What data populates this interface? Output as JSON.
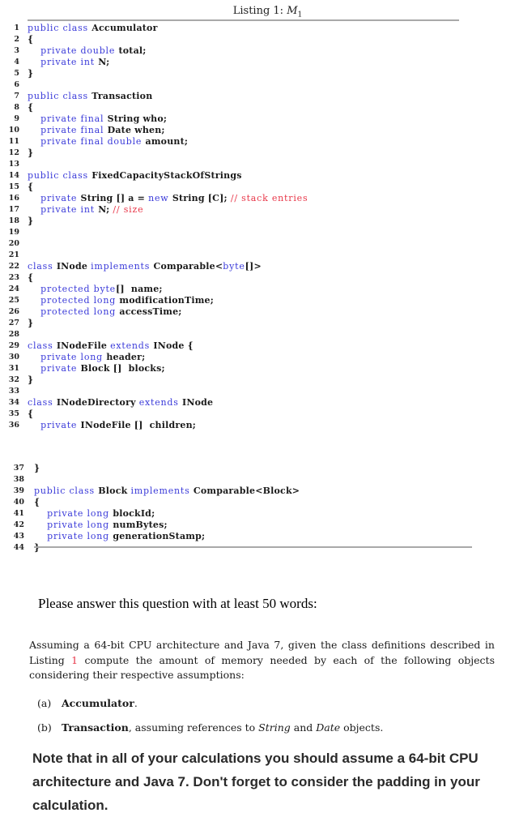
{
  "listing": {
    "caption_prefix": "Listing 1: ",
    "caption_math": "M",
    "caption_sub": "1"
  },
  "code_part_a": [
    {
      "n": "1",
      "tokens": [
        [
          "kw",
          "public class "
        ],
        [
          "tx",
          "Accumulator"
        ]
      ]
    },
    {
      "n": "2",
      "tokens": [
        [
          "tx",
          "{"
        ]
      ]
    },
    {
      "n": "3",
      "tokens": [
        [
          "tx",
          "    "
        ],
        [
          "kw",
          "private double "
        ],
        [
          "tx",
          "total;"
        ]
      ]
    },
    {
      "n": "4",
      "tokens": [
        [
          "tx",
          "    "
        ],
        [
          "kw",
          "private int "
        ],
        [
          "tx",
          "N;"
        ]
      ]
    },
    {
      "n": "5",
      "tokens": [
        [
          "tx",
          "}"
        ]
      ]
    },
    {
      "n": "6",
      "tokens": []
    },
    {
      "n": "7",
      "tokens": [
        [
          "kw",
          "public class "
        ],
        [
          "tx",
          "Transaction"
        ]
      ]
    },
    {
      "n": "8",
      "tokens": [
        [
          "tx",
          "{"
        ]
      ]
    },
    {
      "n": "9",
      "tokens": [
        [
          "tx",
          "    "
        ],
        [
          "kw",
          "private final "
        ],
        [
          "tx",
          "String who;"
        ]
      ]
    },
    {
      "n": "10",
      "tokens": [
        [
          "tx",
          "    "
        ],
        [
          "kw",
          "private final "
        ],
        [
          "tx",
          "Date when;"
        ]
      ]
    },
    {
      "n": "11",
      "tokens": [
        [
          "tx",
          "    "
        ],
        [
          "kw",
          "private final double "
        ],
        [
          "tx",
          "amount;"
        ]
      ]
    },
    {
      "n": "12",
      "tokens": [
        [
          "tx",
          "}"
        ]
      ]
    },
    {
      "n": "13",
      "tokens": []
    },
    {
      "n": "14",
      "tokens": [
        [
          "kw",
          "public class "
        ],
        [
          "tx",
          "FixedCapacityStackOfStrings"
        ]
      ]
    },
    {
      "n": "15",
      "tokens": [
        [
          "tx",
          "{"
        ]
      ]
    },
    {
      "n": "16",
      "tokens": [
        [
          "tx",
          "    "
        ],
        [
          "kw",
          "private "
        ],
        [
          "tx",
          "String [] a = "
        ],
        [
          "kw",
          "new "
        ],
        [
          "tx",
          "String [C]; "
        ],
        [
          "cm",
          "// stack entries"
        ]
      ]
    },
    {
      "n": "17",
      "tokens": [
        [
          "tx",
          "    "
        ],
        [
          "kw",
          "private int "
        ],
        [
          "tx",
          "N; "
        ],
        [
          "cm",
          "// size"
        ]
      ]
    },
    {
      "n": "18",
      "tokens": [
        [
          "tx",
          "}"
        ]
      ]
    },
    {
      "n": "19",
      "tokens": []
    },
    {
      "n": "20",
      "tokens": []
    },
    {
      "n": "21",
      "tokens": []
    },
    {
      "n": "22",
      "tokens": [
        [
          "kw",
          "class "
        ],
        [
          "tx",
          "INode "
        ],
        [
          "kw",
          "implements "
        ],
        [
          "tx",
          "Comparable<"
        ],
        [
          "kw",
          "byte"
        ],
        [
          "tx",
          "[]>"
        ]
      ]
    },
    {
      "n": "23",
      "tokens": [
        [
          "tx",
          "{"
        ]
      ]
    },
    {
      "n": "24",
      "tokens": [
        [
          "tx",
          "    "
        ],
        [
          "kw",
          "protected byte"
        ],
        [
          "tx",
          "[]  name;"
        ]
      ]
    },
    {
      "n": "25",
      "tokens": [
        [
          "tx",
          "    "
        ],
        [
          "kw",
          "protected long "
        ],
        [
          "tx",
          "modificationTime;"
        ]
      ]
    },
    {
      "n": "26",
      "tokens": [
        [
          "tx",
          "    "
        ],
        [
          "kw",
          "protected long "
        ],
        [
          "tx",
          "accessTime;"
        ]
      ]
    },
    {
      "n": "27",
      "tokens": [
        [
          "tx",
          "}"
        ]
      ]
    },
    {
      "n": "28",
      "tokens": []
    },
    {
      "n": "29",
      "tokens": [
        [
          "kw",
          "class "
        ],
        [
          "tx",
          "INodeFile "
        ],
        [
          "kw",
          "extends "
        ],
        [
          "tx",
          "INode {"
        ]
      ]
    },
    {
      "n": "30",
      "tokens": [
        [
          "tx",
          "    "
        ],
        [
          "kw",
          "private long "
        ],
        [
          "tx",
          "header;"
        ]
      ]
    },
    {
      "n": "31",
      "tokens": [
        [
          "tx",
          "    "
        ],
        [
          "kw",
          "private "
        ],
        [
          "tx",
          "Block []  blocks;"
        ]
      ]
    },
    {
      "n": "32",
      "tokens": [
        [
          "tx",
          "}"
        ]
      ]
    },
    {
      "n": "33",
      "tokens": []
    },
    {
      "n": "34",
      "tokens": [
        [
          "kw",
          "class "
        ],
        [
          "tx",
          "INodeDirectory "
        ],
        [
          "kw",
          "extends "
        ],
        [
          "tx",
          "INode"
        ]
      ]
    },
    {
      "n": "35",
      "tokens": [
        [
          "tx",
          "{"
        ]
      ]
    },
    {
      "n": "36",
      "tokens": [
        [
          "tx",
          "    "
        ],
        [
          "kw",
          "private "
        ],
        [
          "tx",
          "INodeFile []  children;"
        ]
      ]
    }
  ],
  "code_part_b": [
    {
      "n": "37",
      "tokens": [
        [
          "tx",
          "}"
        ]
      ]
    },
    {
      "n": "38",
      "tokens": []
    },
    {
      "n": "39",
      "tokens": [
        [
          "kw",
          "public class "
        ],
        [
          "tx",
          "Block "
        ],
        [
          "kw",
          "implements "
        ],
        [
          "tx",
          "Comparable<Block>"
        ]
      ]
    },
    {
      "n": "40",
      "tokens": [
        [
          "tx",
          "{"
        ]
      ]
    },
    {
      "n": "41",
      "tokens": [
        [
          "tx",
          "    "
        ],
        [
          "kw",
          "private long "
        ],
        [
          "tx",
          "blockId;"
        ]
      ]
    },
    {
      "n": "42",
      "tokens": [
        [
          "tx",
          "    "
        ],
        [
          "kw",
          "private long "
        ],
        [
          "tx",
          "numBytes;"
        ]
      ]
    },
    {
      "n": "43",
      "tokens": [
        [
          "tx",
          "    "
        ],
        [
          "kw",
          "private long "
        ],
        [
          "tx",
          "generationStamp;"
        ]
      ]
    },
    {
      "n": "44",
      "tokens": [
        [
          "tx",
          "}"
        ]
      ]
    }
  ],
  "prompt": "Please answer this question with at least 50 words:",
  "question": {
    "before_ref": "Assuming a 64-bit CPU architecture and Java 7, given the class definitions described in Listing ",
    "ref": "1",
    "after_ref": " compute the amount of memory needed by each of the following objects considering their respective assumptions:"
  },
  "items": [
    {
      "label": "(a)",
      "bold": "Accumulator",
      "rest": ".",
      "italic_parts": []
    },
    {
      "label": "(b)",
      "bold": "Transaction",
      "rest_pre": ", assuming references to ",
      "it1": "String",
      "mid": " and ",
      "it2": "Date",
      "rest_post": " objects."
    }
  ],
  "note": "Note that in all of your calculations you should assume a 64-bit CPU architecture and Java 7. Don't forget to consider the padding in your calculation.",
  "colors": {
    "keyword": "#3a3ad9",
    "comment": "#e8384a",
    "rule": "#a9a9a9"
  }
}
